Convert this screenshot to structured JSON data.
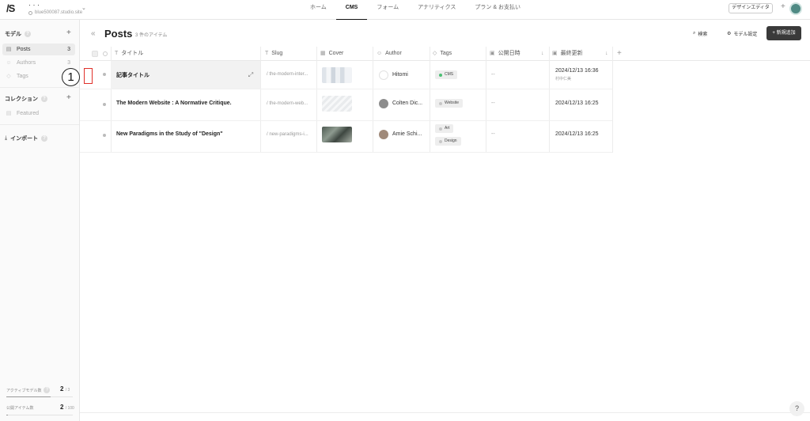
{
  "topbar": {
    "logo": "/S",
    "project_name": "· · ·",
    "project_url": "blue500087.studio.site",
    "tabs": [
      {
        "label": "ホーム"
      },
      {
        "label": "CMS"
      },
      {
        "label": "フォーム"
      },
      {
        "label": "アナリティクス"
      },
      {
        "label": "プラン & お支払い"
      }
    ],
    "design_editor": "デザインエディタ"
  },
  "sidebar": {
    "model_heading": "モデル",
    "items": [
      {
        "label": "Posts",
        "count": "3"
      },
      {
        "label": "Authors",
        "count": "3"
      },
      {
        "label": "Tags",
        "count": ""
      }
    ],
    "collection_heading": "コレクション",
    "collections": [
      {
        "label": "Featured"
      }
    ],
    "import_label": "インポート",
    "stats": [
      {
        "label": "アクティブモデル数",
        "value": "2",
        "total": "/ 3",
        "fraction": 0.67
      },
      {
        "label": "公開アイテム数",
        "value": "2",
        "total": "/ 100",
        "fraction": 0.02
      }
    ]
  },
  "main": {
    "title": "Posts",
    "item_count": "3 件のアイテム",
    "search_label": "検索",
    "settings_label": "モデル設定",
    "new_label": "新規追加",
    "columns": [
      {
        "label": "タイトル"
      },
      {
        "label": "Slug"
      },
      {
        "label": "Cover"
      },
      {
        "label": "Author"
      },
      {
        "label": "Tags"
      },
      {
        "label": "公開日時"
      },
      {
        "label": "最終更新"
      }
    ],
    "rows": [
      {
        "title": "記事タイトル",
        "slug": "/ the-modern-inter...",
        "author": "Hitomi",
        "tags": [
          "CMS"
        ],
        "published": "--",
        "updated": "2024/12/13 16:36",
        "updated_by": "村中仁美"
      },
      {
        "title": "The Modern Website : A Normative Critique.",
        "slug": "/ the-modern-web...",
        "author": "Colten Dic...",
        "tags": [
          "Website"
        ],
        "published": "--",
        "updated": "2024/12/13 16:25",
        "updated_by": ""
      },
      {
        "title": "New Paradigms in the Study of \"Design\"",
        "slug": "/ new-paradigms-i...",
        "author": "Amie Schi...",
        "tags": [
          "Art",
          "Design"
        ],
        "published": "--",
        "updated": "2024/12/13 16:25",
        "updated_by": ""
      }
    ]
  },
  "annotation": {
    "marker": "1"
  },
  "help": "?"
}
